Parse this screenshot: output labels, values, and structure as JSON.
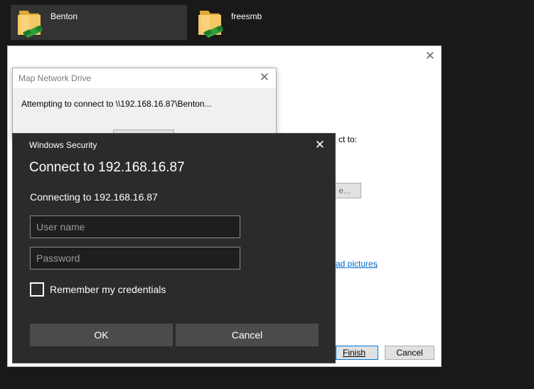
{
  "desktop": {
    "items": [
      {
        "label": "Benton",
        "selected": true
      },
      {
        "label": "freesmb",
        "selected": false
      }
    ]
  },
  "wizard": {
    "folder_prompt_fragment": "ct to:",
    "browse_fragment": "e...",
    "link_fragment": "ad pictures",
    "link_trailing": ".",
    "finish_label": "Finish",
    "cancel_label": "Cancel"
  },
  "map_dialog": {
    "title": "Map Network Drive",
    "message": "Attempting to connect to \\\\192.168.16.87\\Benton..."
  },
  "security_dialog": {
    "title": "Windows Security",
    "heading": "Connect to 192.168.16.87",
    "subtext": "Connecting to 192.168.16.87",
    "username_placeholder": "User name",
    "password_placeholder": "Password",
    "remember_label": "Remember my credentials",
    "remember_checked": false,
    "ok_label": "OK",
    "cancel_label": "Cancel"
  },
  "icons": {
    "folder": "network-folder-icon",
    "close": "close-icon",
    "checkbox": "checkbox-icon"
  },
  "colors": {
    "background": "#191919",
    "selection": "#333333",
    "dialog_dark": "#2b2b2b",
    "button_dark": "#4b4b4b",
    "link": "#0066cc",
    "focus": "#0078d7"
  }
}
